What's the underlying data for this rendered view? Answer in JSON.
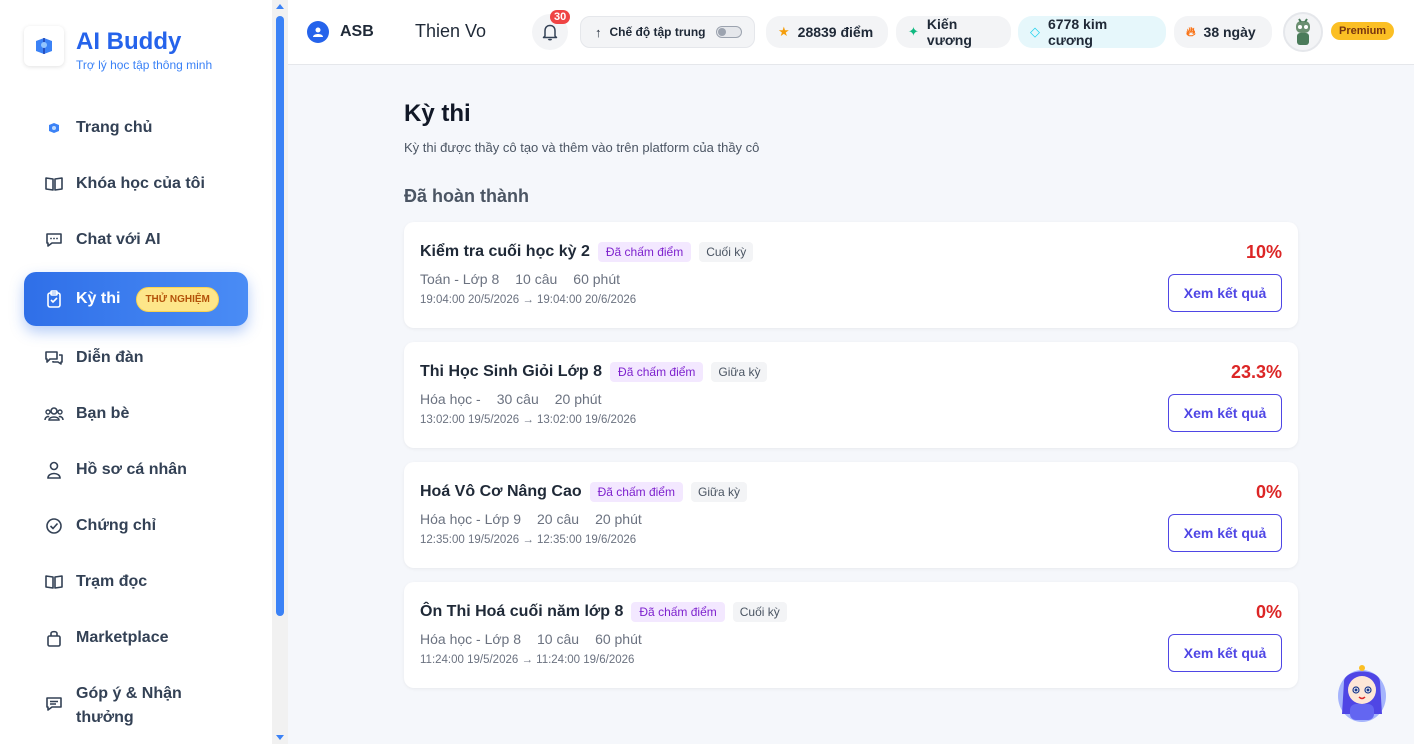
{
  "brand": {
    "title": "AI Buddy",
    "subtitle": "Trợ lý học tập thông minh"
  },
  "sidebar": {
    "items": [
      {
        "label": "Trang chủ",
        "icon": "home-logo-icon"
      },
      {
        "label": "Khóa học của tôi",
        "icon": "book-open-icon"
      },
      {
        "label": "Chat với AI",
        "icon": "chat-icon"
      },
      {
        "label": "Kỳ thi",
        "icon": "clipboard-check-icon",
        "badge": "THỬ NGHIỆM",
        "active": true
      },
      {
        "label": "Diễn đàn",
        "icon": "forum-icon"
      },
      {
        "label": "Bạn bè",
        "icon": "users-icon"
      },
      {
        "label": "Hồ sơ cá nhân",
        "icon": "user-icon"
      },
      {
        "label": "Chứng chỉ",
        "icon": "check-circle-icon"
      },
      {
        "label": "Trạm đọc",
        "icon": "book-open-icon"
      },
      {
        "label": "Marketplace",
        "icon": "lock-bag-icon"
      },
      {
        "label_line1": "Góp ý & Nhận",
        "label_line2": "thưởng",
        "icon": "feedback-icon"
      }
    ]
  },
  "header": {
    "org": "ASB",
    "user_name": "Thien Vo",
    "notification_count": "30",
    "focus_mode_label": "Chế độ tập trung",
    "points": "28839 điểm",
    "rank": "Kiến vương",
    "diamonds": "6778 kim cương",
    "streak": "38 ngày",
    "plan": "Premium"
  },
  "main": {
    "title": "Kỳ thi",
    "subtitle": "Kỳ thi được thầy cô tạo và thêm vào trên platform của thầy cô",
    "section_title": "Đã hoàn thành",
    "exams": [
      {
        "title": "Kiểm tra cuối học kỳ 2",
        "status": "Đã chấm điểm",
        "type": "Cuối kỳ",
        "subject": "Toán - Lớp 8",
        "questions": "10 câu",
        "duration": "60 phút",
        "time": "19:04:00 20/5/2026 → 19:04:00 20/6/2026",
        "score": "10%",
        "button": "Xem kết quả"
      },
      {
        "title": "Thi Học Sinh Giỏi Lớp 8",
        "status": "Đã chấm điểm",
        "type": "Giữa kỳ",
        "subject": "Hóa học -",
        "questions": "30 câu",
        "duration": "20 phút",
        "time": "13:02:00 19/5/2026 → 13:02:00 19/6/2026",
        "score": "23.3%",
        "button": "Xem kết quả"
      },
      {
        "title": "Hoá Vô Cơ Nâng Cao",
        "status": "Đã chấm điểm",
        "type": "Giữa kỳ",
        "subject": "Hóa học - Lớp 9",
        "questions": "20 câu",
        "duration": "20 phút",
        "time": "12:35:00 19/5/2026 → 12:35:00 19/6/2026",
        "score": "0%",
        "button": "Xem kết quả"
      },
      {
        "title": "Ôn Thi Hoá cuối năm lớp 8",
        "status": "Đã chấm điểm",
        "type": "Cuối kỳ",
        "subject": "Hóa học - Lớp 8",
        "questions": "10 câu",
        "duration": "60 phút",
        "time": "11:24:00 19/5/2026 → 11:24:00 19/6/2026",
        "score": "0%",
        "button": "Xem kết quả"
      }
    ]
  },
  "colors": {
    "primary": "#2563eb",
    "accent": "#4f46e5",
    "score": "#dc2626",
    "badge": "#fde68a"
  }
}
